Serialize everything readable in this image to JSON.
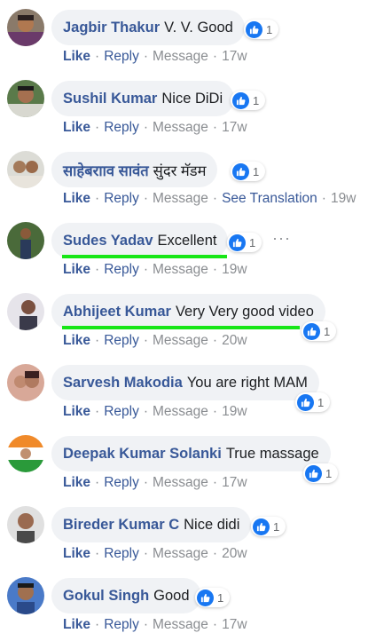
{
  "actions": {
    "like": "Like",
    "reply": "Reply",
    "message": "Message",
    "see_translation": "See Translation",
    "separator": "·"
  },
  "more_icon": "···",
  "comments": [
    {
      "name": "Jagbir Thakur",
      "text": "V. V. Good",
      "likes": "1",
      "time": "17w"
    },
    {
      "name": "Sushil Kumar",
      "text": "Nice DiDi",
      "likes": "1",
      "time": "17w"
    },
    {
      "name": "साहेबरााव सावंत",
      "text": "सुंदर मॅडम",
      "likes": "1",
      "time": "19w"
    },
    {
      "name": "Sudes Yadav",
      "text": "Excellent",
      "likes": "1",
      "time": "19w"
    },
    {
      "name": "Abhijeet Kumar",
      "text": "Very Very good video",
      "likes": "1",
      "time": "20w"
    },
    {
      "name": "Sarvesh Makodia",
      "text": "You are right MAM",
      "likes": "1",
      "time": "19w"
    },
    {
      "name": "Deepak Kumar Solanki",
      "text": "True massage",
      "likes": "1",
      "time": "17w"
    },
    {
      "name": "Bireder Kumar C",
      "text": "Nice didi",
      "likes": "1",
      "time": "20w"
    },
    {
      "name": "Gokul Singh",
      "text": "Good",
      "likes": "1",
      "time": "17w"
    }
  ],
  "colors": {
    "name_blue": "#385898",
    "like_blue": "#1877f2",
    "bubble_bg": "#f0f2f5",
    "meta_gray": "#8a8d91",
    "highlight_green": "#17e617"
  }
}
